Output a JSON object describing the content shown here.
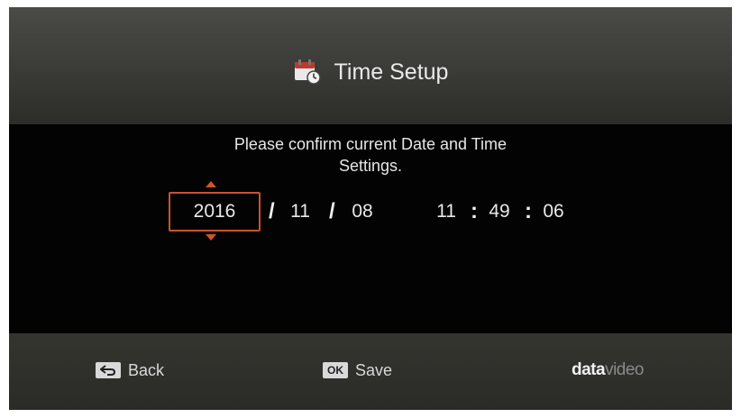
{
  "header": {
    "title": "Time Setup",
    "icon": "calendar-clock-icon"
  },
  "prompt": {
    "line1": "Please confirm current Date and Time",
    "line2": "Settings."
  },
  "datetime": {
    "year": "2016",
    "month": "11",
    "day": "08",
    "hour": "11",
    "minute": "49",
    "second": "06",
    "date_separator": "/",
    "time_separator": ":",
    "selected_field": "year",
    "accent_color": "#c9532e"
  },
  "footer": {
    "back_key": "back-arrow-icon",
    "back_label": "Back",
    "ok_key": "OK",
    "save_label": "Save",
    "brand_part1": "data",
    "brand_part2": "video"
  }
}
